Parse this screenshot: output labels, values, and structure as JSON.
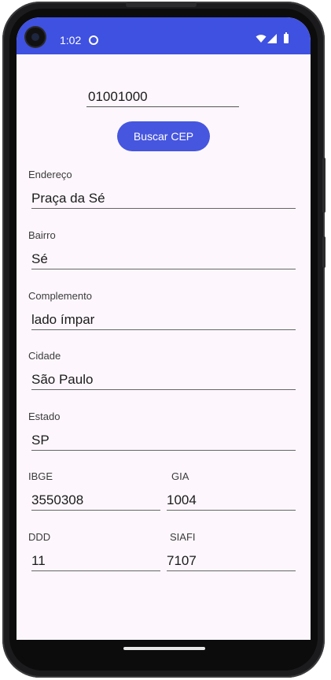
{
  "status_bar": {
    "time": "1:02"
  },
  "cep": {
    "value": "01001000"
  },
  "buscar_button": {
    "label": "Buscar CEP"
  },
  "fields": {
    "endereco": {
      "label": "Endereço",
      "value": "Praça da Sé"
    },
    "bairro": {
      "label": "Bairro",
      "value": "Sé"
    },
    "complemento": {
      "label": "Complemento",
      "value": "lado ímpar"
    },
    "cidade": {
      "label": "Cidade",
      "value": "São Paulo"
    },
    "estado": {
      "label": "Estado",
      "value": "SP"
    },
    "ibge": {
      "label": "IBGE",
      "value": "3550308"
    },
    "gia": {
      "label": "GIA",
      "value": "1004"
    },
    "ddd": {
      "label": "DDD",
      "value": "11"
    },
    "siafi": {
      "label": "SIAFI",
      "value": "7107"
    }
  },
  "colors": {
    "status_bar": "#3f51e0",
    "button": "#4656df",
    "background": "#fdf7fd"
  }
}
